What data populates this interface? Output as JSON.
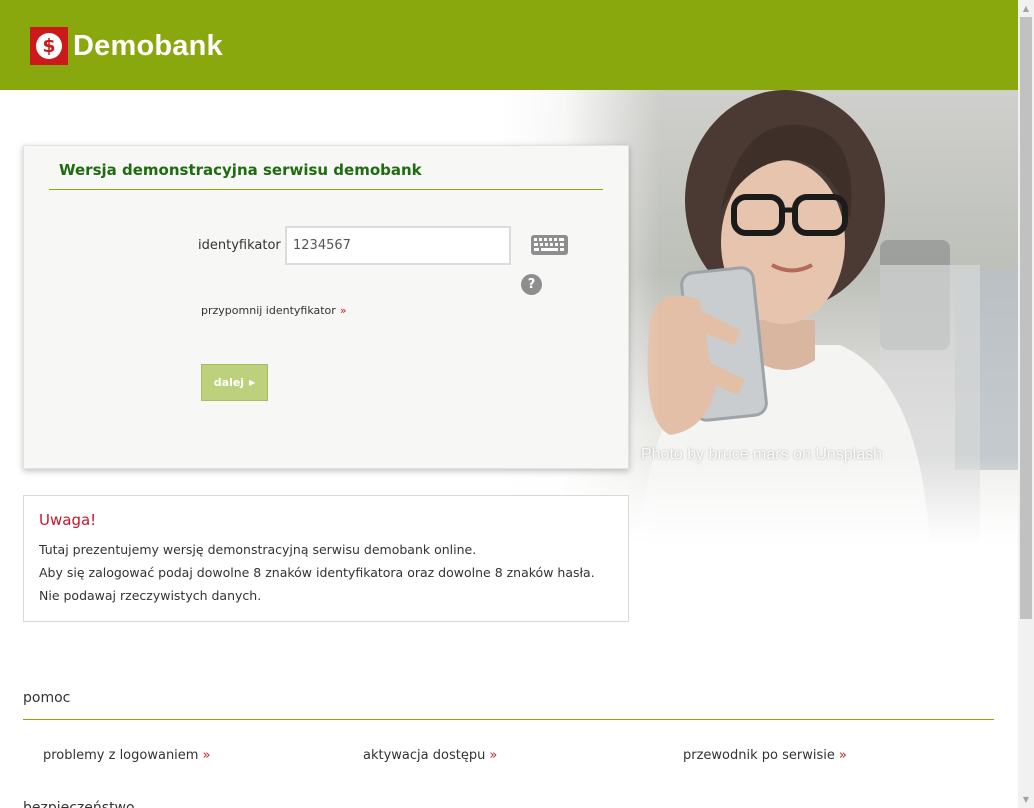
{
  "header": {
    "brand": "Demobank",
    "logo_symbol": "$",
    "bg_color": "#88a80d"
  },
  "hero": {
    "photo_credit": "Photo by bruce mars on Unsplash"
  },
  "login": {
    "title": "Wersja demonstracyjna serwisu demobank",
    "id_label": "identyfikator",
    "id_value": "1234567",
    "keyboard_icon": "keyboard-icon",
    "help_icon": "?",
    "remind_label": "przypomnij identyfikator",
    "remind_arrow": "»",
    "next_label": "dalej",
    "next_caret": "▶"
  },
  "warning": {
    "title": "Uwaga!",
    "line1": "Tutaj prezentujemy wersję demonstracyjną serwisu demobank online.",
    "line2": "Aby się zalogować podaj dowolne 8 znaków identyfikatora oraz dowolne 8 znaków hasła. Nie podawaj rzeczywistych danych."
  },
  "help": {
    "title": "pomoc",
    "links": [
      {
        "label": "problemy z logowaniem",
        "arrow": "»"
      },
      {
        "label": "aktywacja dostępu",
        "arrow": "»"
      },
      {
        "label": "przewodnik po serwisie",
        "arrow": "»"
      }
    ]
  },
  "next_section_title": "bezpieczeństwo",
  "scrollbar": {
    "up_glyph": "▲",
    "down_glyph": "▼"
  }
}
